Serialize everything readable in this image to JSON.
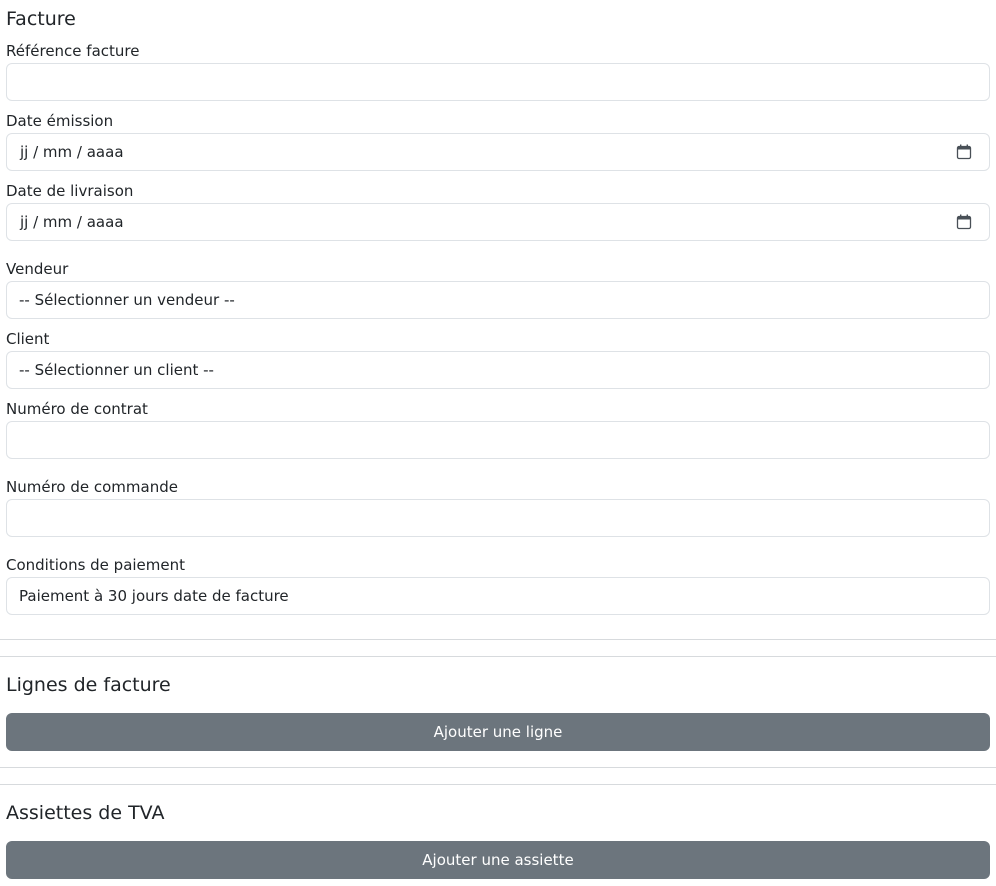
{
  "invoice": {
    "title": "Facture",
    "fields": {
      "reference": {
        "label": "Référence facture",
        "value": ""
      },
      "issue_date": {
        "label": "Date émission",
        "placeholder": "jj / mm / aaaa"
      },
      "delivery_date": {
        "label": "Date de livraison",
        "placeholder": "jj / mm / aaaa"
      },
      "seller": {
        "label": "Vendeur",
        "selected": "-- Sélectionner un vendeur --"
      },
      "client": {
        "label": "Client",
        "selected": "-- Sélectionner un client --"
      },
      "contract_number": {
        "label": "Numéro de contrat",
        "value": ""
      },
      "order_number": {
        "label": "Numéro de commande",
        "value": ""
      },
      "payment_terms": {
        "label": "Conditions de paiement",
        "value": "Paiement à 30 jours date de facture"
      }
    }
  },
  "lines": {
    "title": "Lignes de facture",
    "add_label": "Ajouter une ligne"
  },
  "vat": {
    "title": "Assiettes de TVA",
    "add_label": "Ajouter une assiette"
  },
  "icons": {
    "date": "calendar-icon"
  },
  "colors": {
    "button_bg": "#6c757d",
    "border": "#dee2e6"
  }
}
